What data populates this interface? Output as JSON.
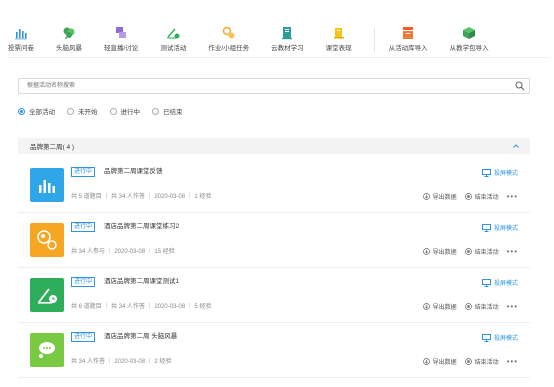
{
  "toolbar": {
    "items": [
      {
        "label": "投票问卷",
        "icon": "bar-chart-icon"
      },
      {
        "label": "头脑风暴",
        "icon": "brainstorm-icon"
      },
      {
        "label": "轻直播/讨论",
        "icon": "live-discussion-icon"
      },
      {
        "label": "测试活动",
        "icon": "test-icon"
      },
      {
        "label": "作业/小组任务",
        "icon": "homework-icon"
      },
      {
        "label": "云教材学习",
        "icon": "cloud-textbook-icon"
      },
      {
        "label": "课堂表现",
        "icon": "class-performance-icon"
      },
      {
        "label": "从活动库导入",
        "icon": "activity-library-icon"
      },
      {
        "label": "从教学包导入",
        "icon": "teaching-package-icon"
      }
    ]
  },
  "search": {
    "placeholder": "根据活动名称搜索"
  },
  "filters": [
    {
      "label": "全部活动",
      "selected": true
    },
    {
      "label": "未开始",
      "selected": false
    },
    {
      "label": "进行中",
      "selected": false
    },
    {
      "label": "已结束",
      "selected": false
    }
  ],
  "group": {
    "title": "品牌第二周( 4 )"
  },
  "actions": {
    "projection": "投屏模式",
    "export": "导出数据",
    "end": "结束活动",
    "more": "•••"
  },
  "activities": [
    {
      "status": "进行中",
      "title": "品牌第二周课堂反馈",
      "meta": "共 5 道题目 ｜ 共 34 人作答 ｜ 2020-03-08 ｜ 1 经验",
      "color": "#2fa6e8",
      "icon": "bar-chart-icon"
    },
    {
      "status": "进行中",
      "title": "酒店品牌第二周课堂练习2",
      "meta": "共 34 人参与 ｜ 2020-03-08 ｜ 15 经验",
      "color": "#f5a623",
      "icon": "homework-icon"
    },
    {
      "status": "进行中",
      "title": "酒店品牌第二周课堂测试1",
      "meta": "共 6 道题目 ｜ 共 34 人作答 ｜ 2020-03-08 ｜ 5 经验",
      "color": "#2eae5b",
      "icon": "test-icon"
    },
    {
      "status": "进行中",
      "title": "酒店品牌第二周 头脑风暴",
      "meta": "共 34 人作答 ｜ 2020-03-08 ｜ 2 经验",
      "color": "#7ac943",
      "icon": "brainstorm-icon"
    }
  ]
}
